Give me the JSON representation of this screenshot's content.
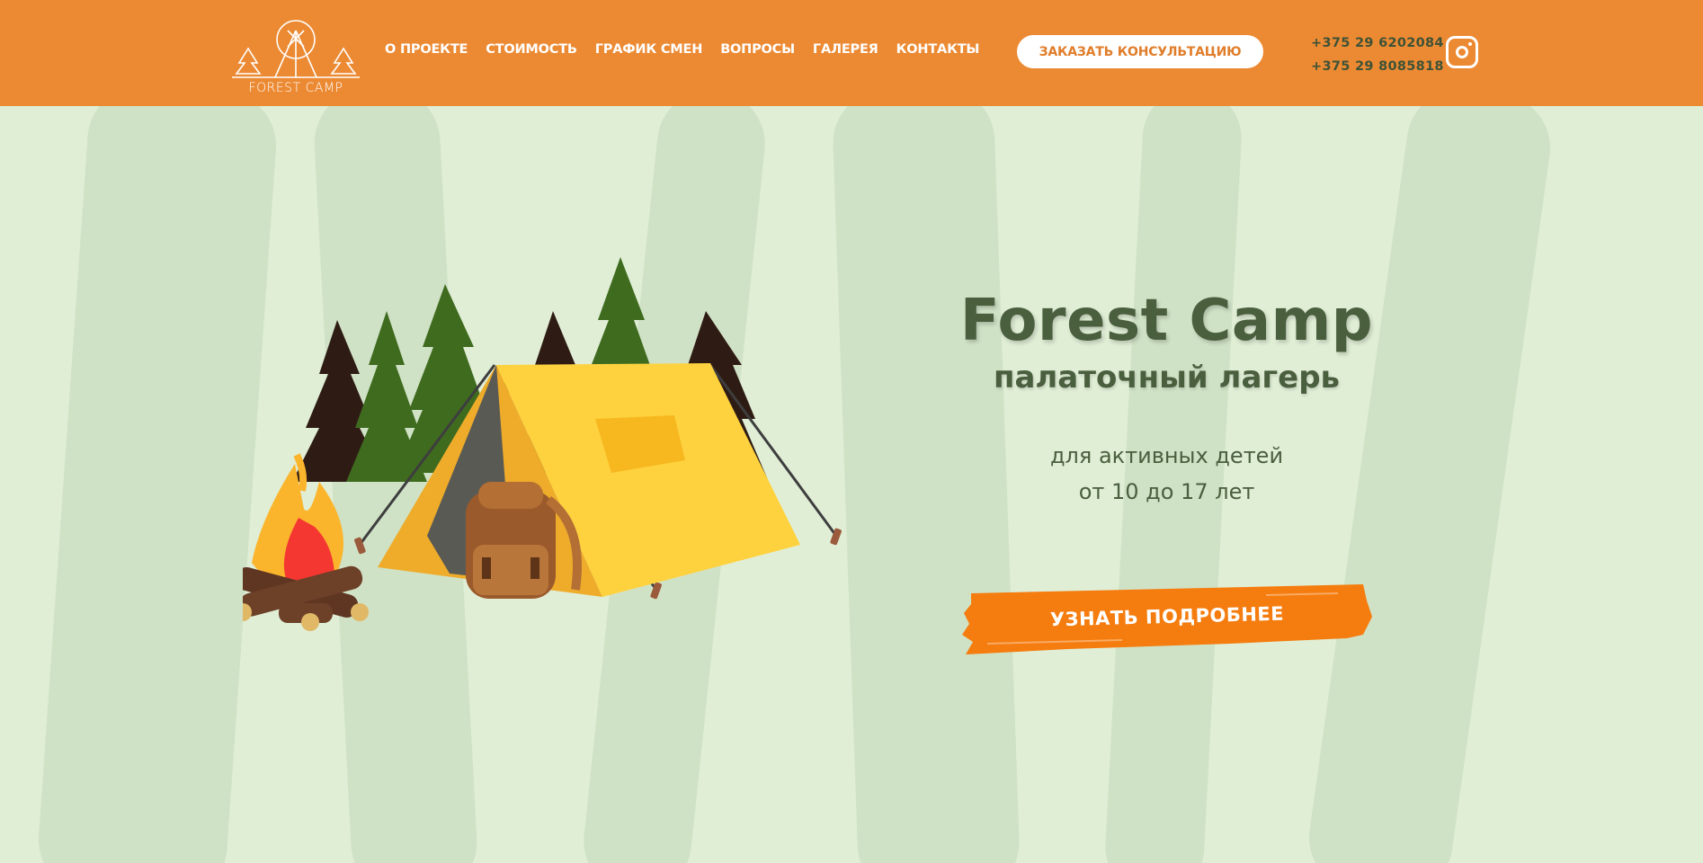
{
  "header": {
    "logo_text": "FOREST CAMP",
    "nav": [
      {
        "label": "О ПРОЕКТЕ"
      },
      {
        "label": "СТОИМОСТЬ"
      },
      {
        "label": "ГРАФИК СМЕН"
      },
      {
        "label": "ВОПРОСЫ"
      },
      {
        "label": "ГАЛЕРЕЯ"
      },
      {
        "label": "КОНТАКТЫ"
      }
    ],
    "consult_button": "ЗАКАЗАТЬ КОНСУЛЬТАЦИЮ",
    "phones": [
      "+375 29 6202084",
      "+375 29 8085818"
    ],
    "social_icon": "instagram-icon"
  },
  "hero": {
    "title": "Forest Camp",
    "subtitle": "палаточный лагерь",
    "tagline_line1": "для активных детей",
    "tagline_line2": "от 10 до 17 лет",
    "cta": "УЗНАТЬ ПОДРОБНЕЕ"
  },
  "colors": {
    "header_bg": "#ec8a33",
    "hero_bg": "#e0eed6",
    "text_dark_green": "#4a5f3e",
    "cta_orange": "#f57c0e"
  }
}
